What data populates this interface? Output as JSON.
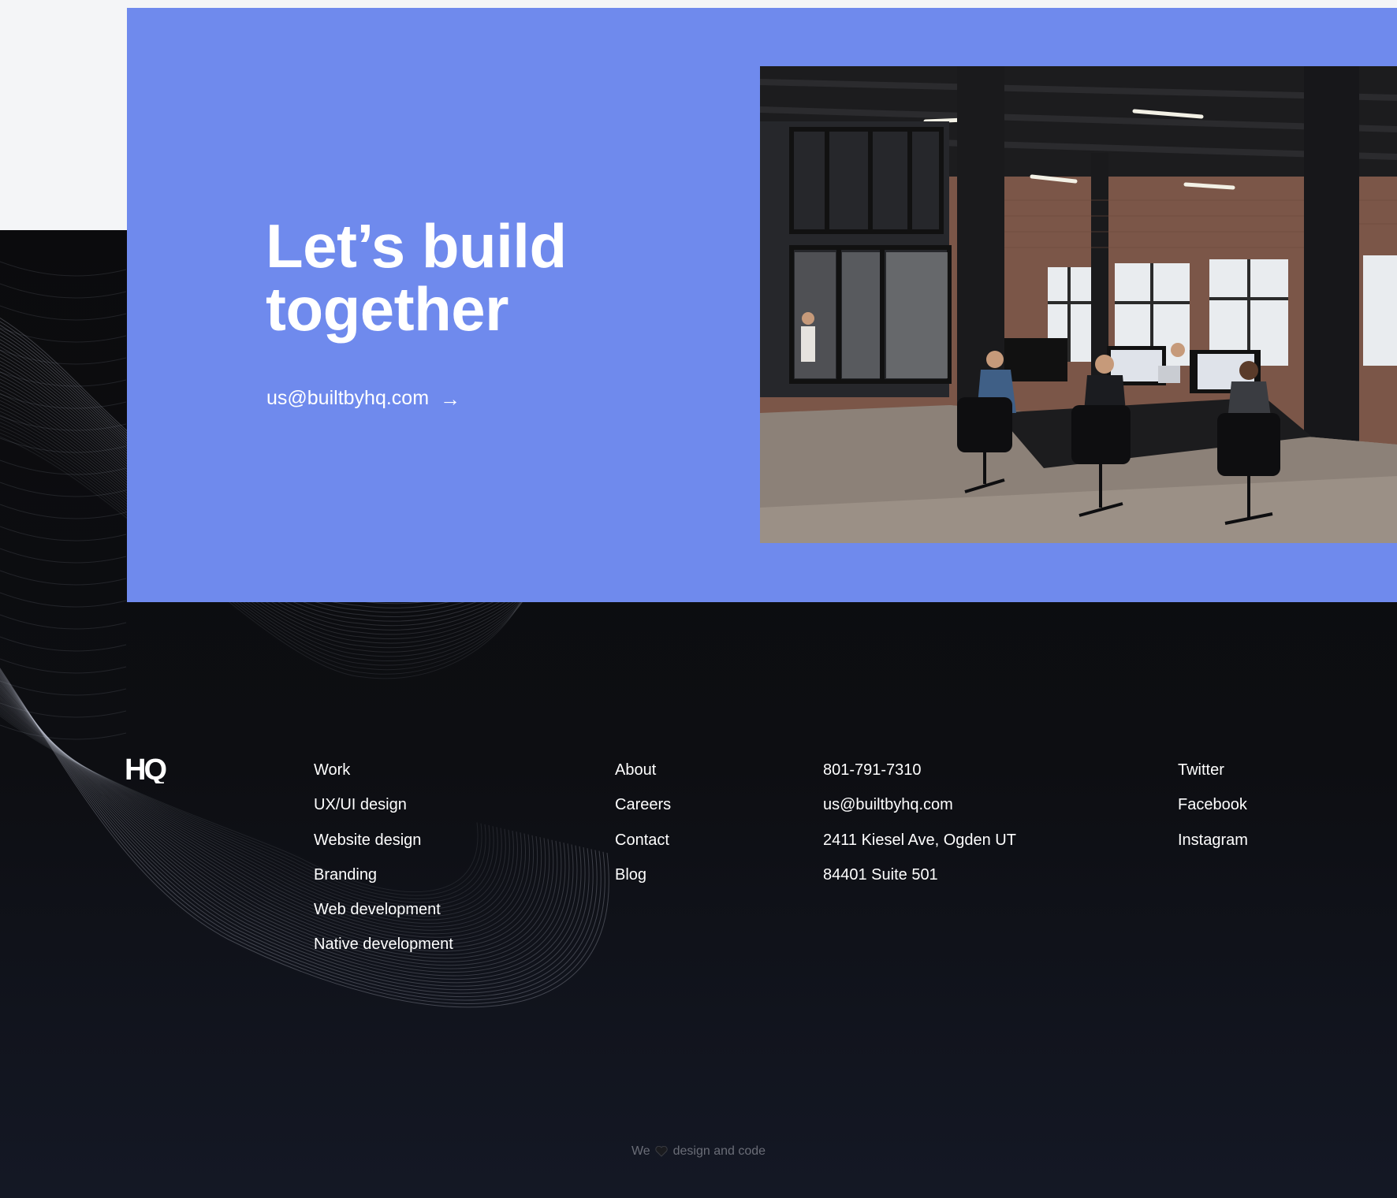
{
  "cta": {
    "title_line1": "Let’s build",
    "title_line2": "together",
    "email": "us@builtbyhq.com",
    "arrow_icon": "arrow-right-icon"
  },
  "photo": {
    "icon": "office-photo"
  },
  "footer": {
    "logo": "HQ",
    "services": [
      "Work",
      "UX/UI design",
      "Website design",
      "Branding",
      "Web development",
      "Native development"
    ],
    "company": [
      "About",
      "Careers",
      "Contact",
      "Blog"
    ],
    "contact": {
      "phone": "801-791-7310",
      "email": "us@builtbyhq.com",
      "address_line1": "2411 Kiesel Ave, Ogden UT",
      "address_line2": "84401 Suite 501"
    },
    "social": [
      "Twitter",
      "Facebook",
      "Instagram"
    ],
    "credit_prefix": "We",
    "credit_suffix": "design and code",
    "credit_icon": "heart-icon"
  },
  "colors": {
    "cta_blue": "#6f8aed",
    "page_gray": "#f4f5f7",
    "footer_dark": "#0b0c10",
    "text_white": "#ffffff",
    "credit_gray": "#6a6d77"
  }
}
